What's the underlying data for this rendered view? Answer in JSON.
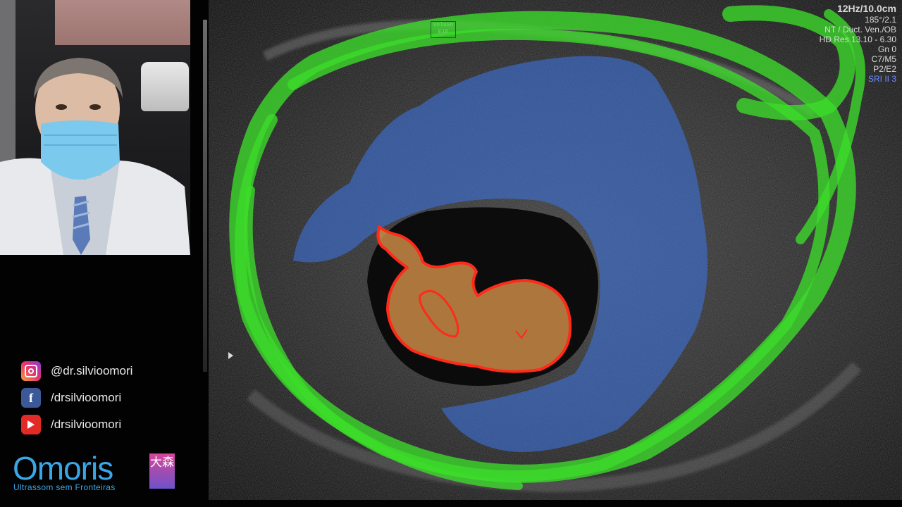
{
  "ultrasound": {
    "mode_box": [
      "Volusn",
      "E10"
    ],
    "params": {
      "main": "12Hz/10.0cm",
      "lines": [
        "185°/2.1",
        "NT / Duct. Ven./OB",
        "HD Res 13.10 - 6.30",
        "Gn   0",
        "C7/M5",
        "P2/E2"
      ],
      "accent_line": "SRI II 3"
    },
    "overlay_colors": {
      "outer_ring": "#3cdc2a",
      "amniotic_region": "#3b6fd6",
      "embryo_fill": "#c98a45",
      "embryo_outline": "#ff2a1a"
    }
  },
  "social": [
    {
      "icon": "instagram-icon",
      "handle": "@dr.silvioomori"
    },
    {
      "icon": "facebook-icon",
      "handle": "/drsilvioomori",
      "glyph": "f"
    },
    {
      "icon": "youtube-icon",
      "handle": "/drsilvioomori"
    }
  ],
  "logo": {
    "word": "Omoris",
    "tagline": "Ultrassom sem Fronteiras",
    "stamp": "大森",
    "color": "#3aa6e6"
  }
}
